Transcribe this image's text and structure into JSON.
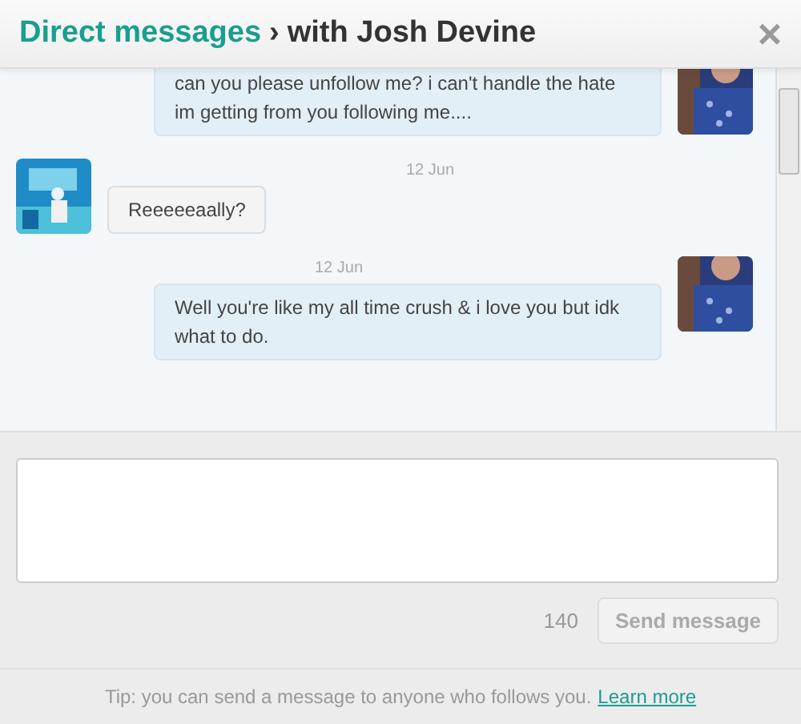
{
  "header": {
    "breadcrumb": "Direct messages",
    "separator": "›",
    "title": "with Josh Devine",
    "close": "×"
  },
  "messages": [
    {
      "kind": "sent",
      "text": "can you please unfollow me? i can't handle the hate im getting from you following me...."
    },
    {
      "kind": "received",
      "date": "12 Jun",
      "text": "Reeeeeaally?"
    },
    {
      "kind": "sent",
      "date": "12 Jun",
      "text": "Well you're like my all time crush & i love you but idk what to do."
    }
  ],
  "composer": {
    "counter": "140",
    "send_button": "Send message",
    "send_disabled": true
  },
  "footer": {
    "tip": "Tip: you can send a message to anyone who follows you.",
    "link": "Learn more"
  }
}
